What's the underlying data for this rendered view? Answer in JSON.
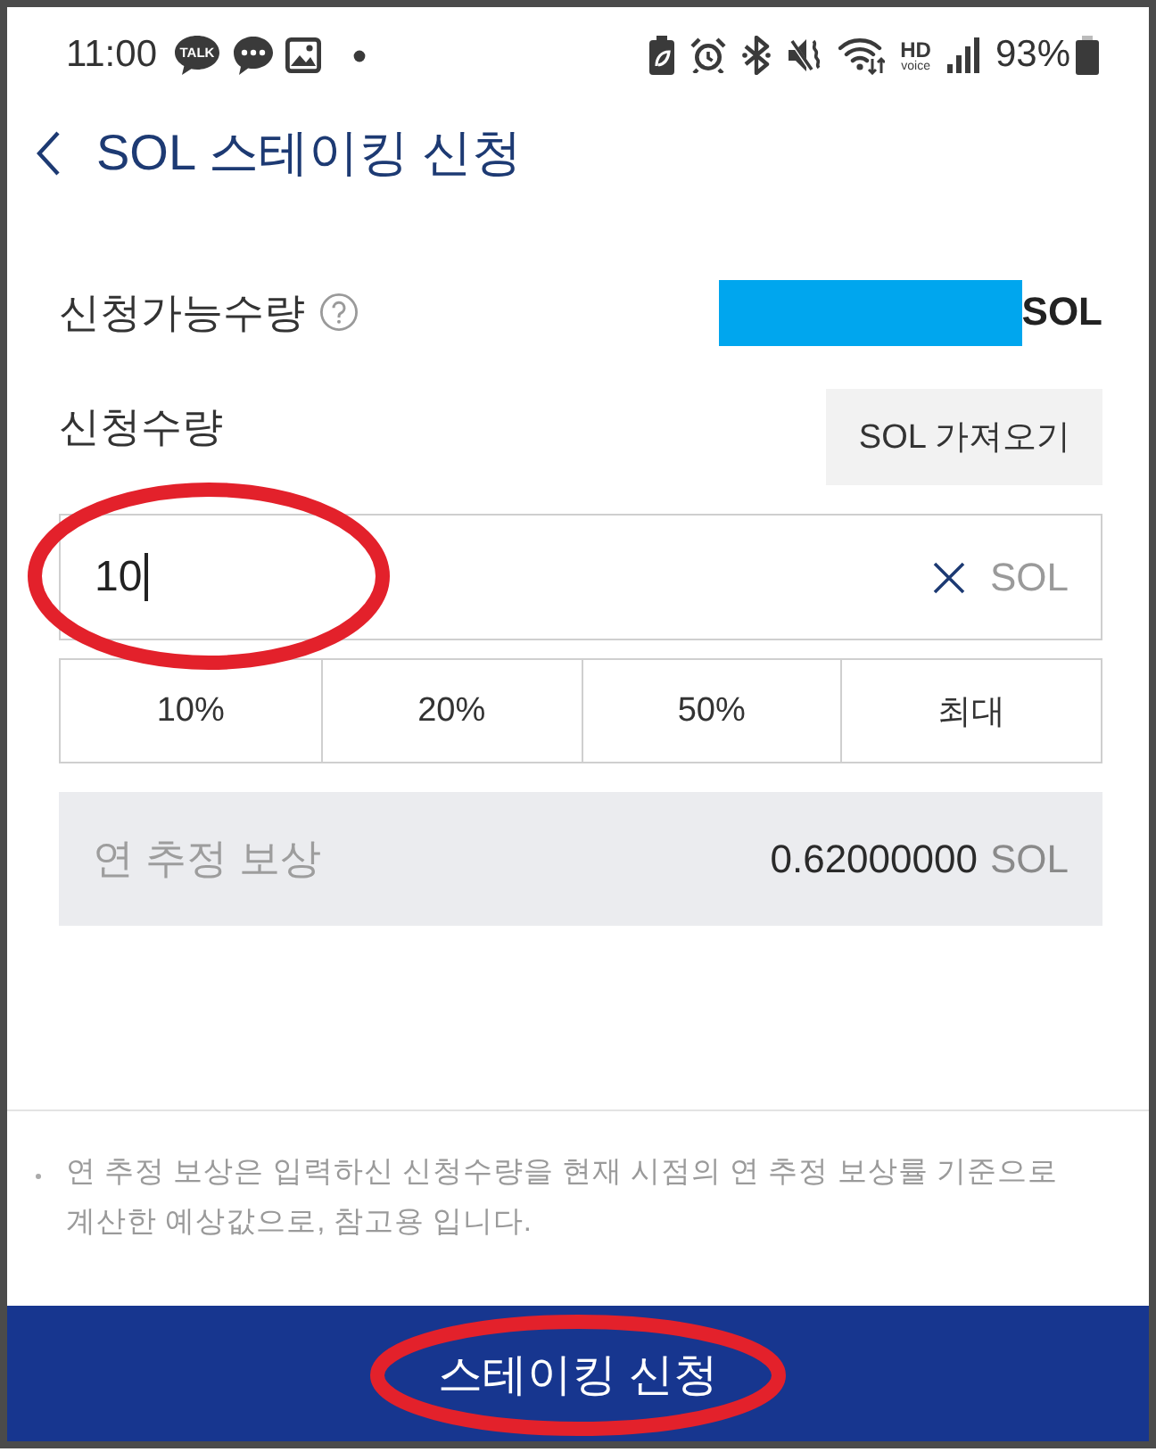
{
  "status_bar": {
    "time": "11:00",
    "notifications": [
      {
        "kind": "talk",
        "label": "TALK"
      },
      {
        "kind": "chat"
      },
      {
        "kind": "gallery"
      },
      {
        "kind": "dot"
      }
    ],
    "indicators": [
      {
        "kind": "battery_saver"
      },
      {
        "kind": "alarm"
      },
      {
        "kind": "bluetooth"
      },
      {
        "kind": "mute"
      },
      {
        "kind": "wifi"
      },
      {
        "kind": "hd_voice",
        "label": "HD",
        "sublabel": "voice"
      },
      {
        "kind": "signal"
      }
    ],
    "battery": "93%"
  },
  "header": {
    "title": "SOL 스테이킹 신청"
  },
  "available": {
    "label": "신청가능수량",
    "redacted": true,
    "unit": "SOL"
  },
  "request": {
    "label": "신청수량",
    "fetch_button": "SOL 가져오기"
  },
  "amount_field": {
    "value": "10",
    "unit": "SOL",
    "circled": true
  },
  "percent_buttons": [
    {
      "label": "10%"
    },
    {
      "label": "20%"
    },
    {
      "label": "50%"
    },
    {
      "label": "최대"
    }
  ],
  "estimate": {
    "label": "연 추정 보상",
    "amount": "0.62000000",
    "unit": "SOL"
  },
  "notes": [
    "연 추정 보상은 입력하신 신청수량을 현재 시점의 연 추정 보상률 기준으로 계산한 예상값으로, 참고용 입니다."
  ],
  "submit_button": {
    "label": "스테이킹 신청",
    "circled": true
  }
}
